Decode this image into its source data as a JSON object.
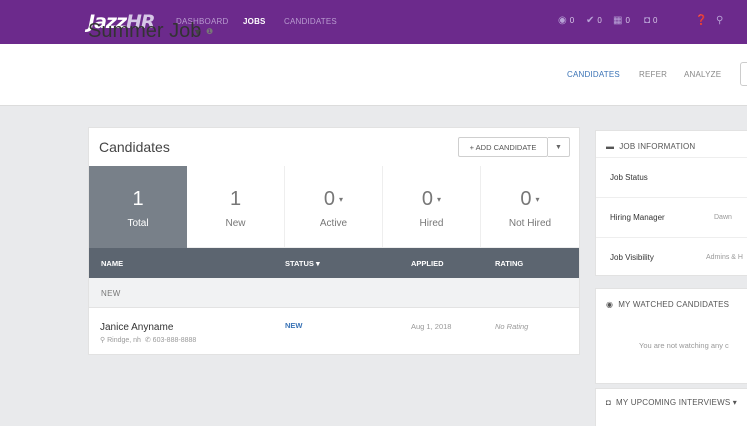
{
  "topnav": {
    "logo_main": "Jazz",
    "logo_suffix": "HR",
    "items": [
      "DASHBOARD",
      "JOBS",
      "CANDIDATES"
    ],
    "stats": [
      {
        "icon": "eye-icon",
        "value": "0"
      },
      {
        "icon": "check-icon",
        "value": "0"
      },
      {
        "icon": "calendar-icon",
        "value": "0"
      },
      {
        "icon": "chat-icon",
        "value": "0"
      }
    ]
  },
  "job": {
    "title": "Summer Job",
    "tabs": [
      "CANDIDATES",
      "REFER",
      "ANALYZE"
    ]
  },
  "candidates_card": {
    "title": "Candidates",
    "add_label": "+ ADD CANDIDATE",
    "stats": [
      {
        "value": "1",
        "label": "Total",
        "selected": true,
        "caret": false
      },
      {
        "value": "1",
        "label": "New",
        "selected": false,
        "caret": false
      },
      {
        "value": "0",
        "label": "Active",
        "selected": false,
        "caret": true
      },
      {
        "value": "0",
        "label": "Hired",
        "selected": false,
        "caret": true
      },
      {
        "value": "0",
        "label": "Not Hired",
        "selected": false,
        "caret": true
      }
    ],
    "columns": [
      "NAME",
      "STATUS ▾",
      "APPLIED",
      "RATING"
    ],
    "section": "NEW",
    "rows": [
      {
        "name": "Janice Anyname",
        "location": "Rindge, nh",
        "phone": "603-888-8888",
        "status": "NEW",
        "applied": "Aug 1, 2018",
        "rating": "No Rating"
      }
    ]
  },
  "job_info": {
    "title": "JOB INFORMATION",
    "rows": [
      {
        "key": "Job Status",
        "value": ""
      },
      {
        "key": "Hiring Manager",
        "value": "Dawn"
      },
      {
        "key": "Job Visibility",
        "value": "Admins & H"
      }
    ]
  },
  "watched": {
    "title": "MY WATCHED CANDIDATES",
    "message": "You are not watching any c"
  },
  "interviews": {
    "title": "MY UPCOMING INTERVIEWS ▾"
  }
}
